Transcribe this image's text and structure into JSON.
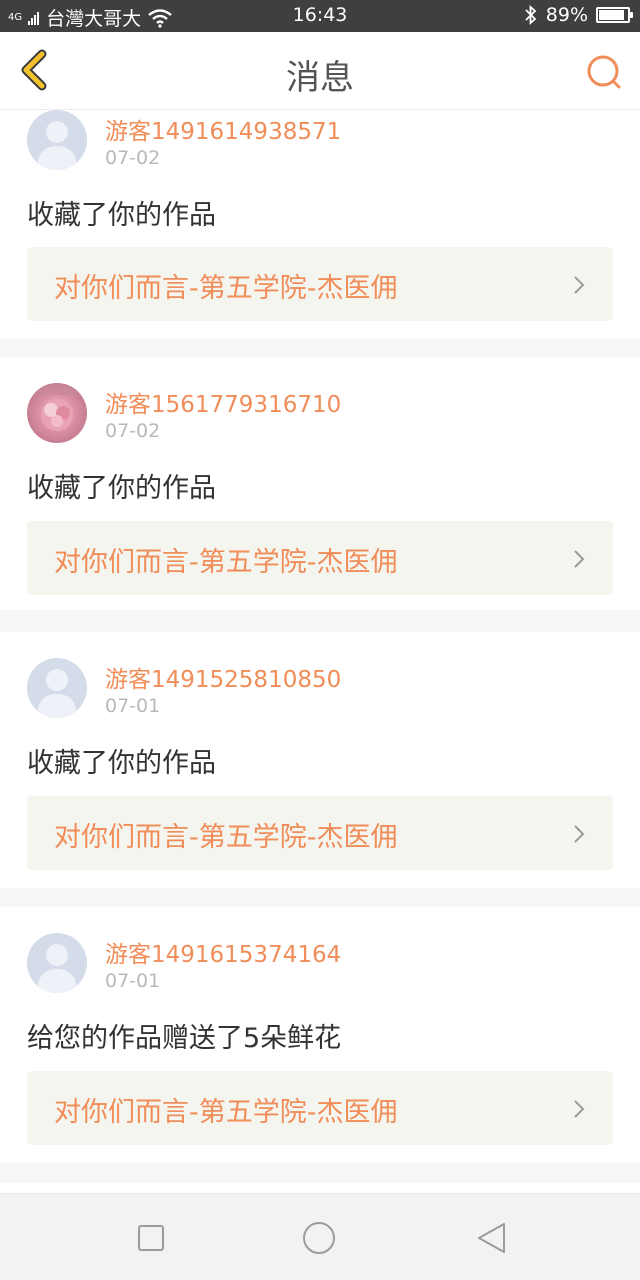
{
  "status_bar": {
    "signal_label": "4G",
    "carrier": "台灣大哥大",
    "time": "16:43",
    "battery": "89%",
    "battery_level": 0.89
  },
  "header": {
    "title": "消息",
    "back_icon": "chevron-left-icon",
    "search_icon": "search-icon"
  },
  "messages": [
    {
      "username": "游客1491614938571",
      "date": "07-02",
      "action": "收藏了你的作品",
      "work_title": "对你们而言-第五学院-杰医佣",
      "avatar": "default-avatar"
    },
    {
      "username": "游客1561779316710",
      "date": "07-02",
      "action": "收藏了你的作品",
      "work_title": "对你们而言-第五学院-杰医佣",
      "avatar": "photo-avatar"
    },
    {
      "username": "游客1491525810850",
      "date": "07-01",
      "action": "收藏了你的作品",
      "work_title": "对你们而言-第五学院-杰医佣",
      "avatar": "default-avatar"
    },
    {
      "username": "游客1491615374164",
      "date": "07-01",
      "action": "给您的作品赠送了5朵鲜花",
      "work_title": "对你们而言-第五学院-杰医佣",
      "avatar": "default-avatar"
    }
  ],
  "nav_bar": {
    "buttons": [
      "recent-apps-icon",
      "home-icon",
      "back-triangle-icon"
    ]
  },
  "colors": {
    "accent": "#f08d58",
    "back_icon": "#f2c12e",
    "status_bar_bg": "#3f3f3f"
  }
}
